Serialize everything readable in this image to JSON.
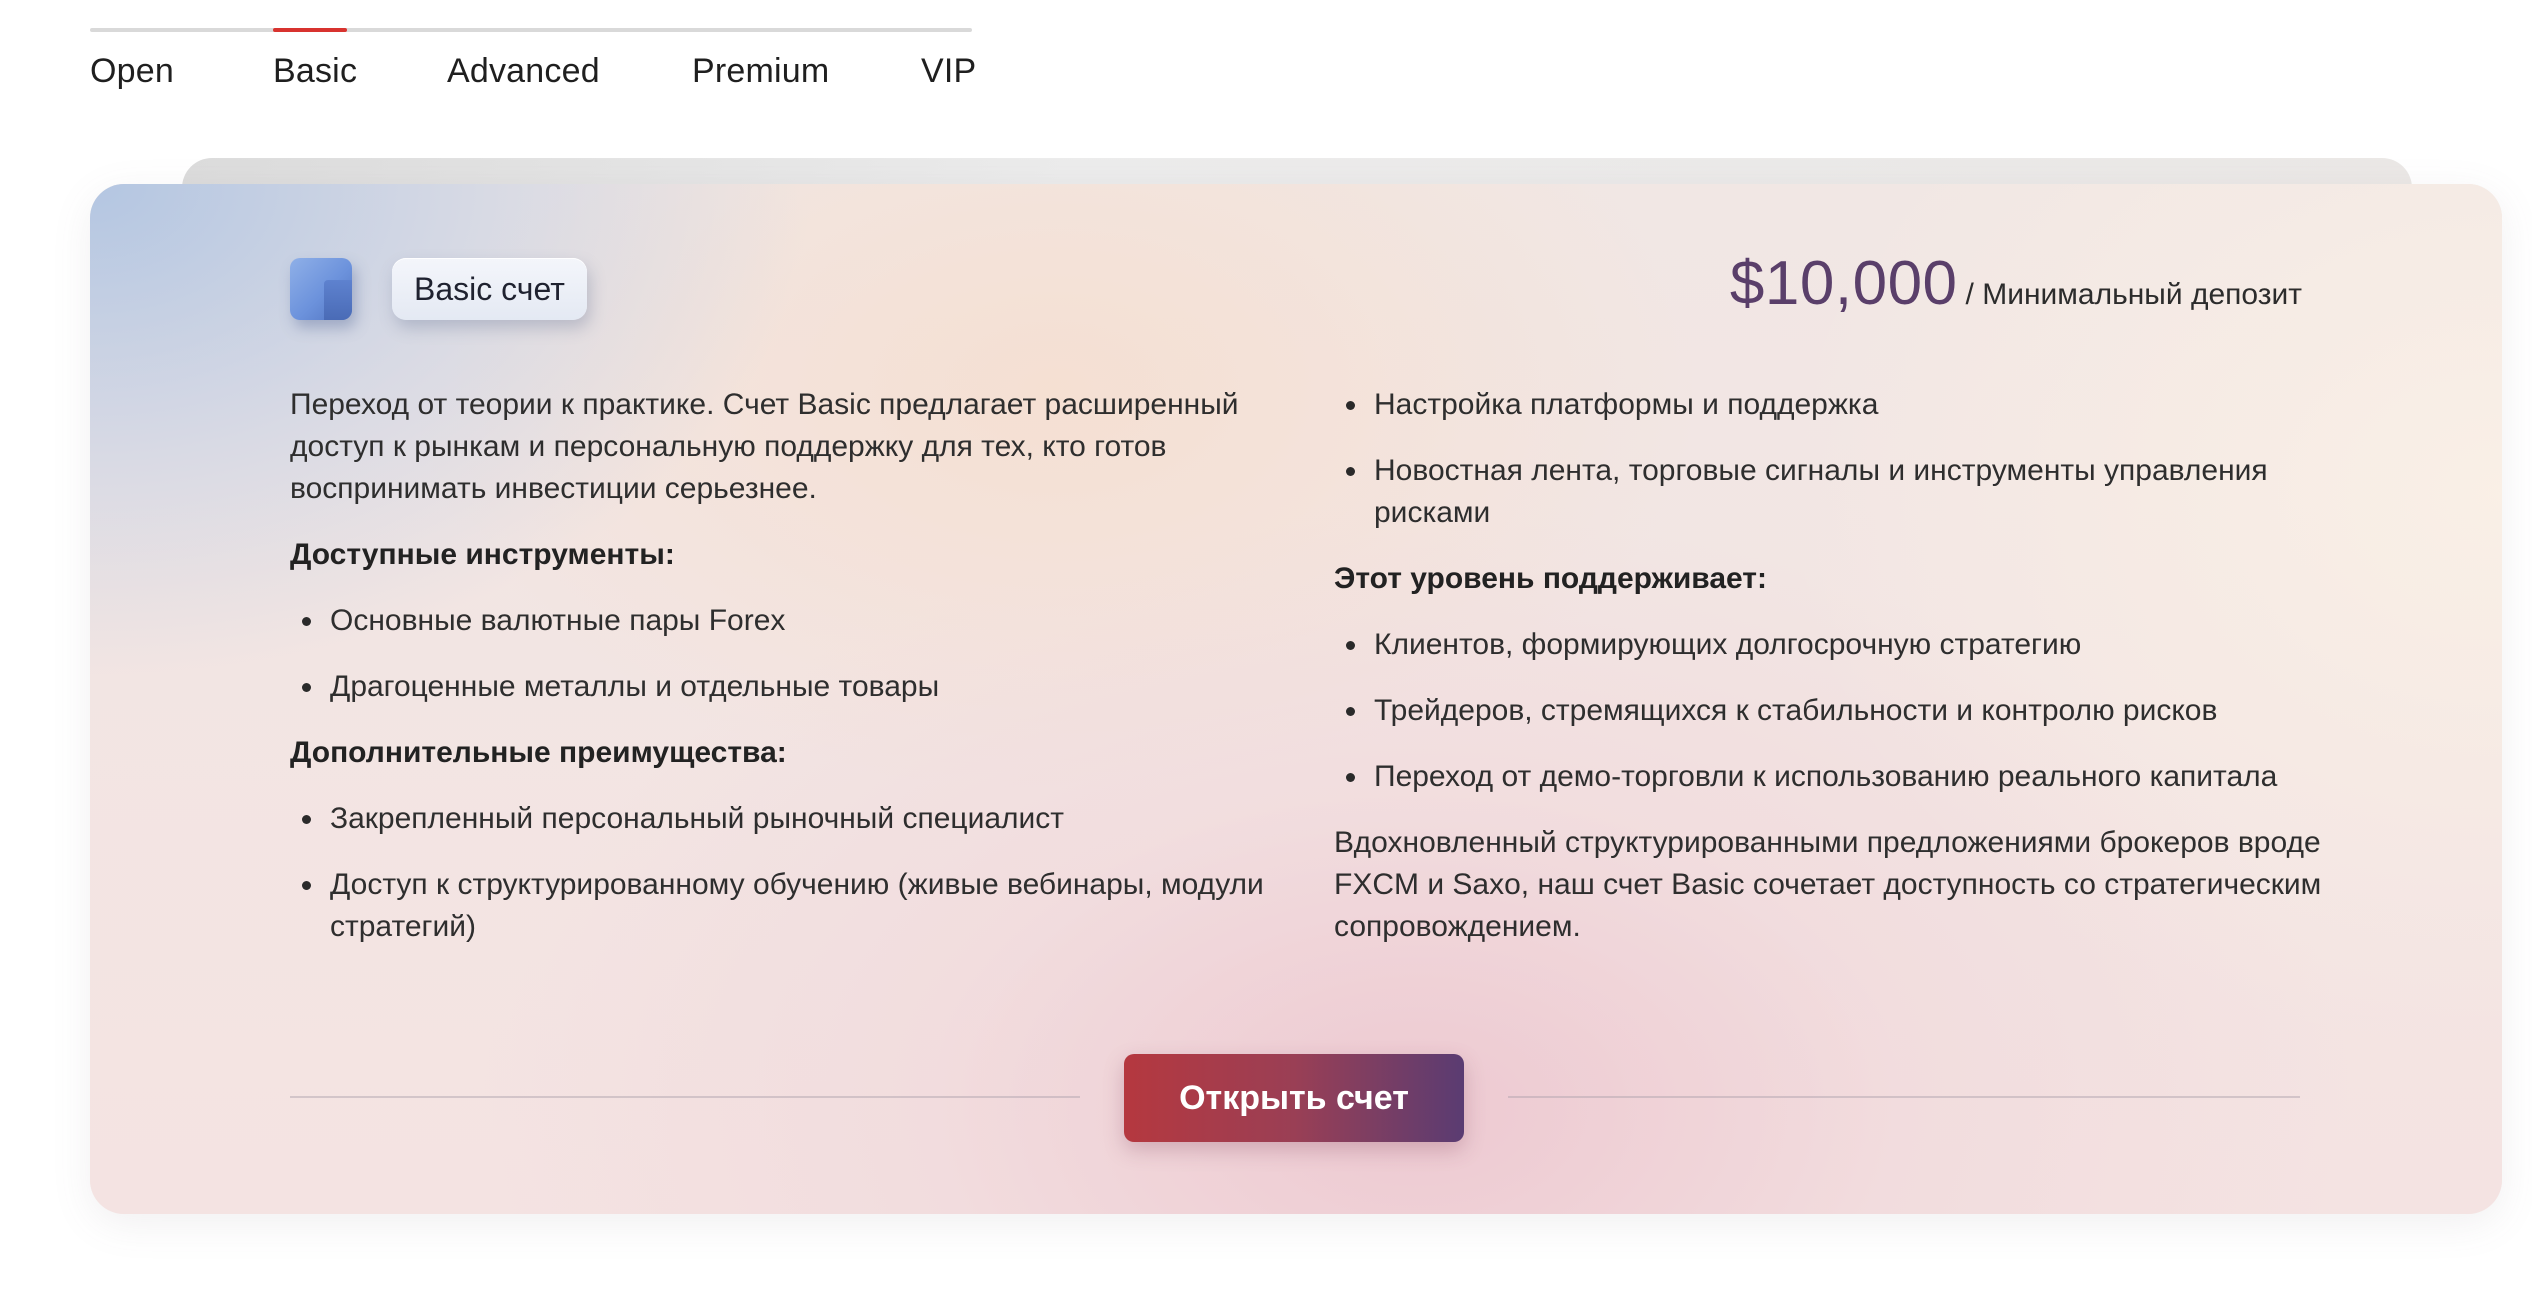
{
  "tabs": [
    {
      "label": "Open"
    },
    {
      "label": "Basic",
      "active": true
    },
    {
      "label": "Advanced"
    },
    {
      "label": "Premium"
    },
    {
      "label": "VIP"
    }
  ],
  "colors": {
    "accent_red": "#d8332f",
    "price": "#5a3f6a",
    "button_start": "#b5383f",
    "button_end": "#5a3c72"
  },
  "card": {
    "logo_icon": "cube-icon",
    "badge": "Basic счет",
    "price": "$10,000",
    "price_caption": "/ Минимальный депозит",
    "left": {
      "intro": "Переход от теории к практике. Счет Basic предлагает расширенный доступ к рынкам и персональную поддержку для тех, кто готов воспринимать инвестиции серьезнее.",
      "instruments_heading": "Доступные инструменты:",
      "instruments": [
        "Основные валютные пары Forex",
        "Драгоценные металлы и отдельные товары"
      ],
      "benefits_heading": "Дополнительные преимущества:",
      "benefits": [
        "Закрепленный персональный рыночный специалист",
        "Доступ к структурированному обучению (живые вебинары, модули стратегий)"
      ]
    },
    "right": {
      "benefits_cont": [
        "Настройка платформы и поддержка",
        "Новостная лента, торговые сигналы и инструменты управления рисками"
      ],
      "supports_heading": "Этот уровень поддерживает:",
      "supports": [
        "Клиентов, формирующих долгосрочную стратегию",
        "Трейдеров, стремящихся к стабильности и контролю рисков",
        "Переход от демо-торговли к использованию реального капитала"
      ],
      "outro": "Вдохновленный структурированными предложениями брокеров вроде FXCM и Saxo, наш счет Basic сочетает доступность со стратегическим сопровождением."
    },
    "cta_label": "Открыть счет"
  }
}
